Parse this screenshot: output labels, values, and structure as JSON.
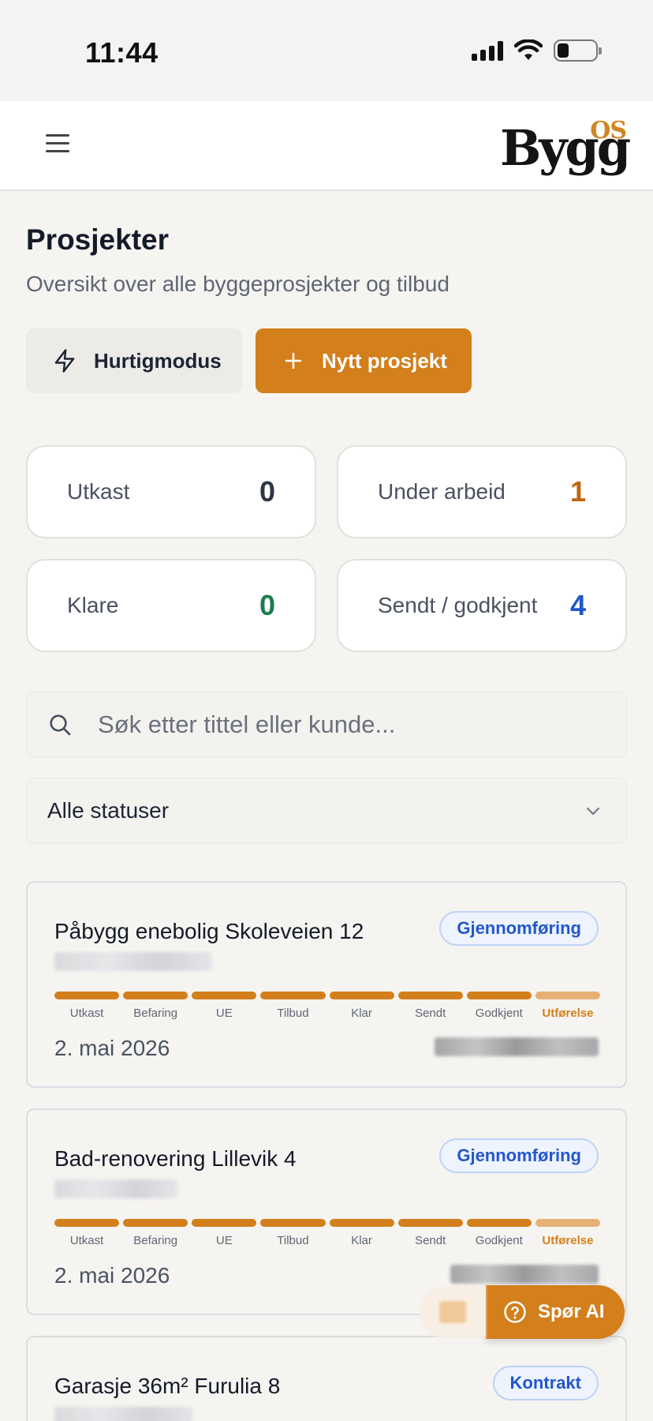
{
  "status_bar": {
    "time": "11:44"
  },
  "header": {
    "logo_main": "Bygg",
    "logo_sup": "OS"
  },
  "page": {
    "title": "Prosjekter",
    "subtitle": "Oversikt over alle byggeprosjekter og tilbud"
  },
  "actions": {
    "quick_mode": "Hurtigmodus",
    "new_project": "Nytt prosjekt"
  },
  "stats": [
    {
      "label": "Utkast",
      "value": "0",
      "color": "#2e3646"
    },
    {
      "label": "Under arbeid",
      "value": "1",
      "color": "#c0650f"
    },
    {
      "label": "Klare",
      "value": "0",
      "color": "#1d7a4e"
    },
    {
      "label": "Sendt / godkjent",
      "value": "4",
      "color": "#2257cc"
    }
  ],
  "search": {
    "placeholder": "Søk etter tittel eller kunde..."
  },
  "filter": {
    "selected": "Alle statuser"
  },
  "steps": [
    "Utkast",
    "Befaring",
    "UE",
    "Tilbud",
    "Klar",
    "Sendt",
    "Godkjent",
    "Utførelse"
  ],
  "projects": [
    {
      "title": "Påbygg enebolig Skoleveien 12",
      "status": "Gjennomføring",
      "date": "2. mai 2026",
      "progress_step": 8
    },
    {
      "title": "Bad-renovering Lillevik 4",
      "status": "Gjennomføring",
      "date": "2. mai 2026",
      "progress_step": 8
    },
    {
      "title": "Garasje 36m² Furulia 8",
      "status": "Kontrakt"
    }
  ],
  "ai_button": {
    "label": "Spør AI"
  },
  "colors": {
    "accent": "#d37f1c",
    "accent_light": "#e6b177",
    "badge_blue": "#2257cc"
  }
}
